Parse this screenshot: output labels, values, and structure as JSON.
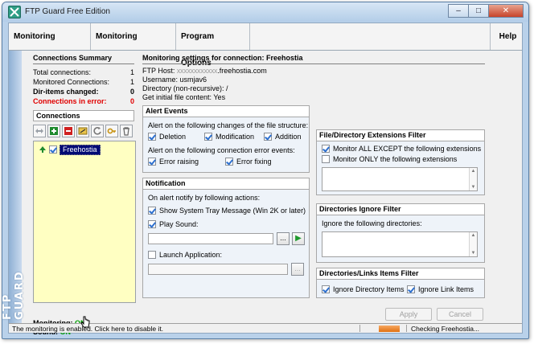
{
  "window": {
    "title": "FTP Guard Free Edition",
    "controls": {
      "minimize": "–",
      "maximize": "□",
      "close": "✕"
    }
  },
  "menu": [
    "Monitoring Results",
    "Monitoring Settings",
    "Program Options",
    "Help"
  ],
  "sidebar": {
    "brand": "FTP GUARD",
    "summary_title": "Connections Summary",
    "summary": [
      {
        "label": "Total connections:",
        "value": "1"
      },
      {
        "label": "Monitored Connections:",
        "value": "1"
      },
      {
        "label": "Dir-items changed:",
        "value": "0"
      },
      {
        "label": "Connections in error:",
        "value": "0"
      }
    ],
    "connections_title": "Connections",
    "toolbar_icons": [
      "swap-arrows-icon",
      "add-icon",
      "remove-icon",
      "edit-icon",
      "refresh-icon",
      "key-icon",
      "trash-icon"
    ],
    "connections": [
      {
        "name": "Freehostia",
        "checked": true
      }
    ],
    "monitoring_label": "Monitoring:",
    "monitoring_value": "ON",
    "sound_label": "Sound:",
    "sound_value": "ON"
  },
  "main": {
    "title": "Monitoring settings for connection: Freehostia",
    "ftp_host_label": "FTP Host:",
    "ftp_host_masked": "xxxxxxxxxxxx",
    "ftp_host_domain": ".freehostia.com",
    "username": "Username: usmjav6",
    "directory": "Directory (non-recursive): /",
    "initial_content": "Get initial file content: Yes"
  },
  "alert_events": {
    "title": "Alert Events",
    "structure_text": "Alert on the following changes of the file structure:",
    "deletion": "Deletion",
    "modification": "Modification",
    "addition": "Addition",
    "error_text": "Alert on the following connection error events:",
    "error_raising": "Error raising",
    "error_fixing": "Error fixing"
  },
  "notification": {
    "title": "Notification",
    "text": "On alert notify by following actions:",
    "tray": "Show System Tray Message (Win 2K or later)",
    "sound": "Play Sound:",
    "sound_path": "",
    "browse": "...",
    "play": "▶",
    "launch": "Launch Application:",
    "app_path": "",
    "app_browse": "..."
  },
  "extensions_filter": {
    "title": "File/Directory Extensions Filter",
    "except": "Monitor ALL EXCEPT the following extensions",
    "only": "Monitor ONLY the following extensions"
  },
  "dirs_ignore": {
    "title": "Directories Ignore Filter",
    "text": "Ignore the following directories:"
  },
  "links_filter": {
    "title": "Directories/Links Items Filter",
    "ignore_dir": "Ignore Directory Items",
    "ignore_link": "Ignore Link Items"
  },
  "buttons": {
    "apply": "Apply",
    "cancel": "Cancel"
  },
  "statusbar": {
    "left": "The monitoring is enabled. Click here to disable it.",
    "right": "Checking Freehostia...",
    "progress": 1.0
  },
  "colors": {
    "accent_green": "#00a000",
    "error_red": "#e00000",
    "progress_orange": "#e07012"
  }
}
